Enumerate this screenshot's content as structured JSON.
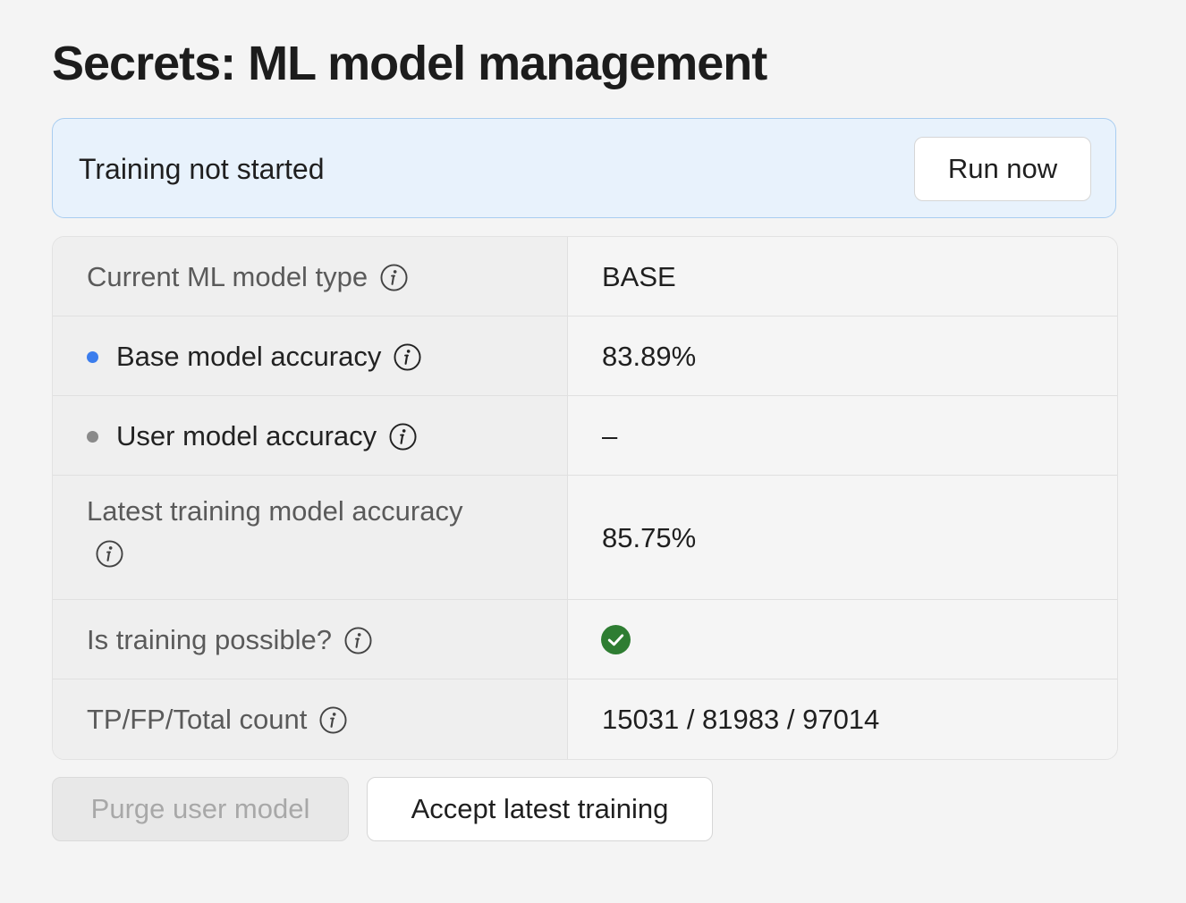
{
  "page": {
    "title": "Secrets: ML model management"
  },
  "banner": {
    "status_text": "Training not started",
    "run_button_label": "Run now",
    "background_color": "#e8f2fc",
    "border_color": "#a9cdf0"
  },
  "table": {
    "rows": [
      {
        "label": "Current ML model type",
        "value": "BASE"
      },
      {
        "label": "Base model accuracy",
        "value": "83.89%",
        "dot_color": "#3b7ded"
      },
      {
        "label": "User model accuracy",
        "value": "–",
        "dot_color": "#8a8a8a"
      },
      {
        "label": "Latest training model accuracy",
        "value": "85.75%"
      },
      {
        "label": "Is training possible?",
        "value_icon": "check-circle-icon",
        "value_icon_color": "#2e7d32"
      },
      {
        "label": "TP/FP/Total count",
        "value": "15031 / 81983 / 97014"
      }
    ],
    "info_icon": "info-circle-icon"
  },
  "actions": {
    "purge_label": "Purge user model",
    "purge_disabled": true,
    "accept_label": "Accept latest training"
  }
}
